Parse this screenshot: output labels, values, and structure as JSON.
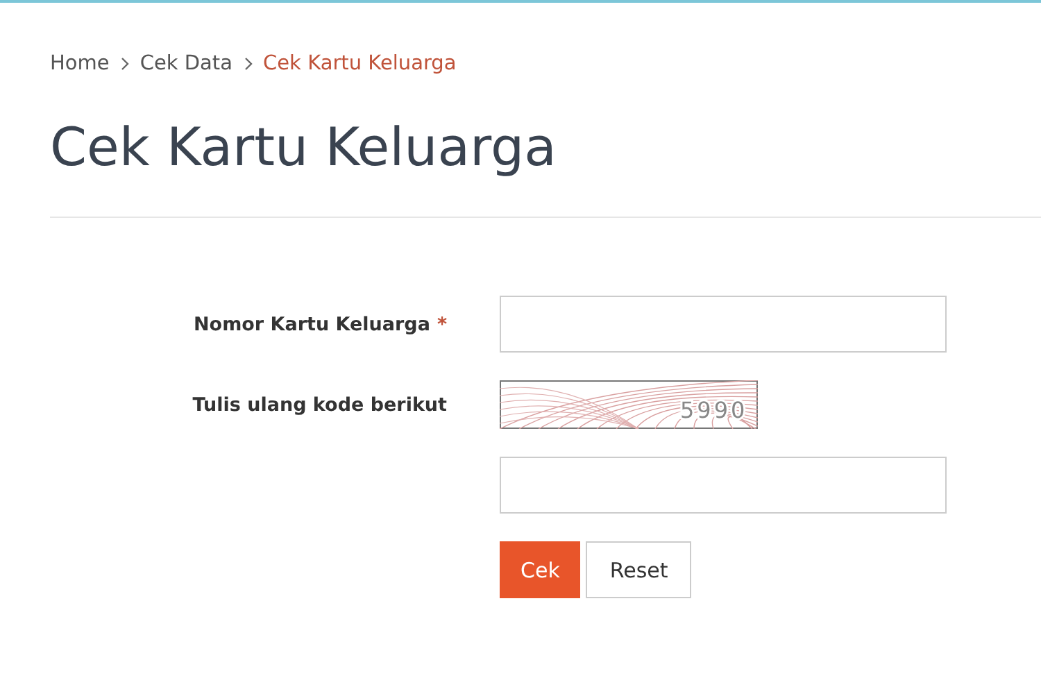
{
  "breadcrumb": [
    {
      "label": "Home",
      "current": false
    },
    {
      "label": "Cek Data",
      "current": false
    },
    {
      "label": "Cek Kartu Keluarga",
      "current": true
    }
  ],
  "title": "Cek Kartu Keluarga",
  "form": {
    "rows": [
      {
        "kind": "text",
        "label": "Nomor Kartu Keluarga",
        "required_mark": "*"
      },
      {
        "kind": "captcha",
        "label": "Tulis ulang kode berikut",
        "code": "5990"
      },
      {
        "kind": "text"
      }
    ],
    "buttons": [
      {
        "label": "Cek",
        "primary": true
      },
      {
        "label": "Reset",
        "primary": false
      }
    ]
  }
}
